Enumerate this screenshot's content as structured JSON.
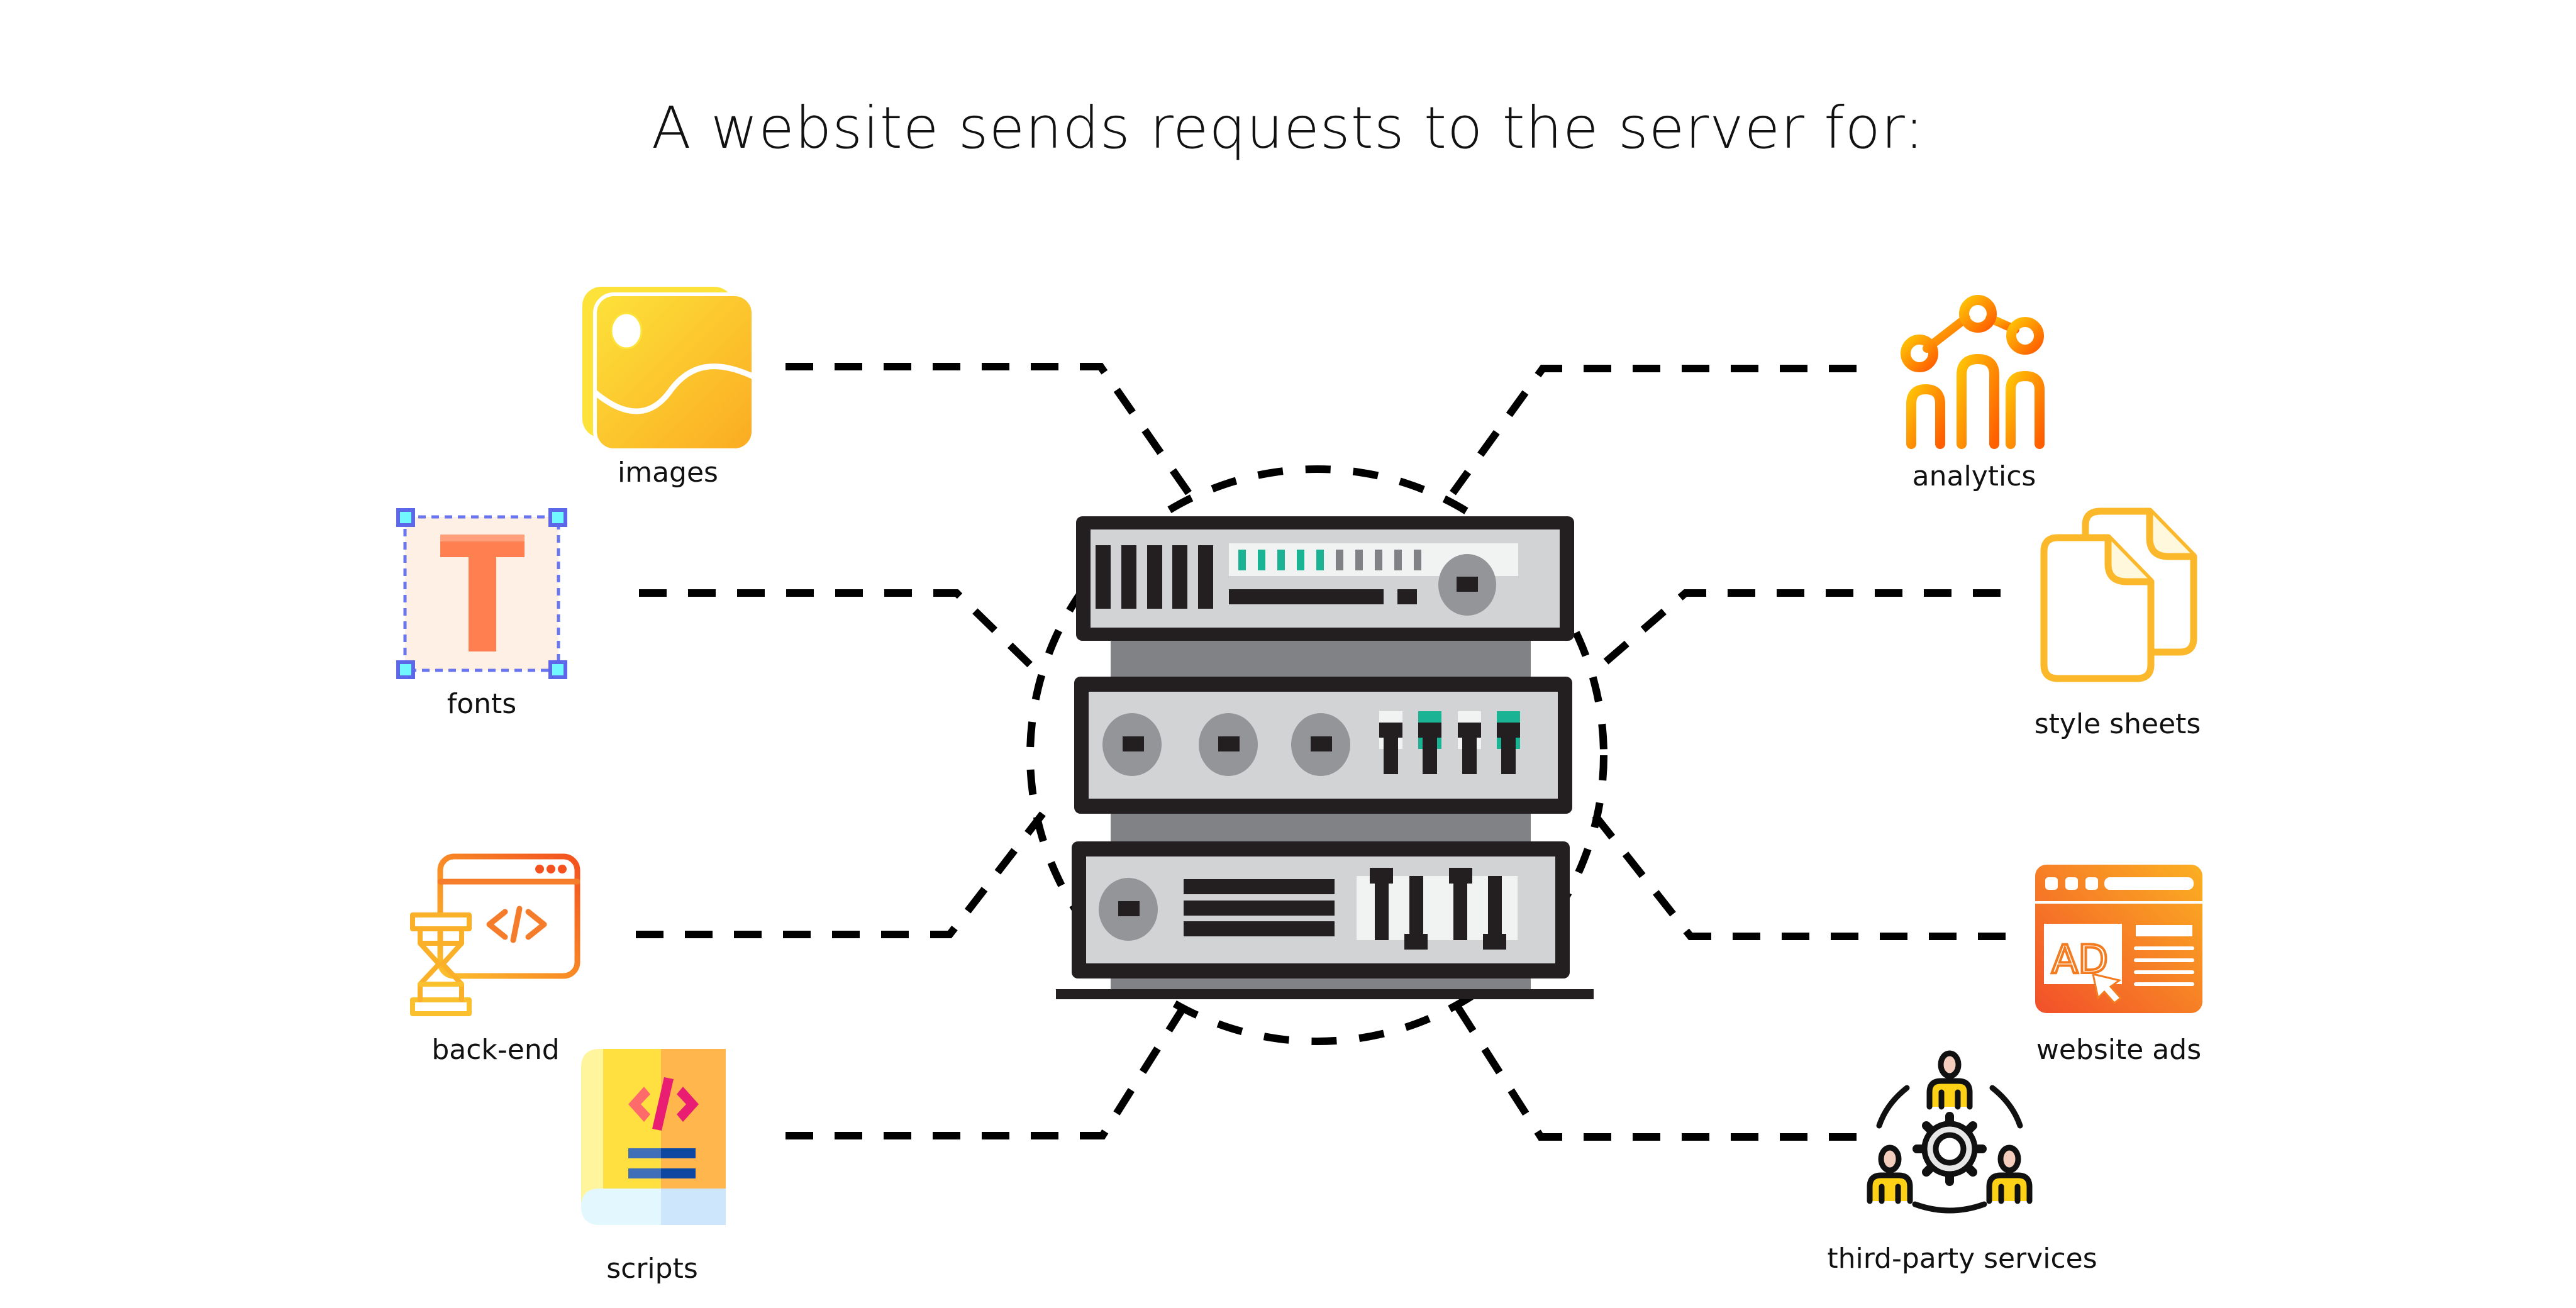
{
  "title": "A website sends requests to the server for:",
  "center": {
    "name": "server",
    "icon": "server-rack-icon"
  },
  "resources": [
    {
      "id": "images",
      "label": "images",
      "icon": "image-icon",
      "side": "left"
    },
    {
      "id": "fonts",
      "label": "fonts",
      "icon": "font-icon",
      "side": "left"
    },
    {
      "id": "back-end",
      "label": "back-end",
      "icon": "code-window-hourglass-icon",
      "side": "left"
    },
    {
      "id": "scripts",
      "label": "scripts",
      "icon": "code-book-icon",
      "side": "left"
    },
    {
      "id": "analytics",
      "label": "analytics",
      "icon": "analytics-chart-icon",
      "side": "right"
    },
    {
      "id": "style-sheets",
      "label": "style sheets",
      "icon": "documents-icon",
      "side": "right"
    },
    {
      "id": "website-ads",
      "label": "website ads",
      "icon": "ad-browser-icon",
      "side": "right"
    },
    {
      "id": "third-party-services",
      "label": "third-party services",
      "icon": "team-gear-icon",
      "side": "right"
    }
  ],
  "colors": {
    "connector": "#000000",
    "server_frame": "#231f20",
    "server_panel": "#d1d3d4",
    "server_led_on": "#1ab394",
    "server_led_off": "#808285",
    "accent_yellow": "#fbc02d",
    "accent_orange": "#ff8a1e"
  }
}
